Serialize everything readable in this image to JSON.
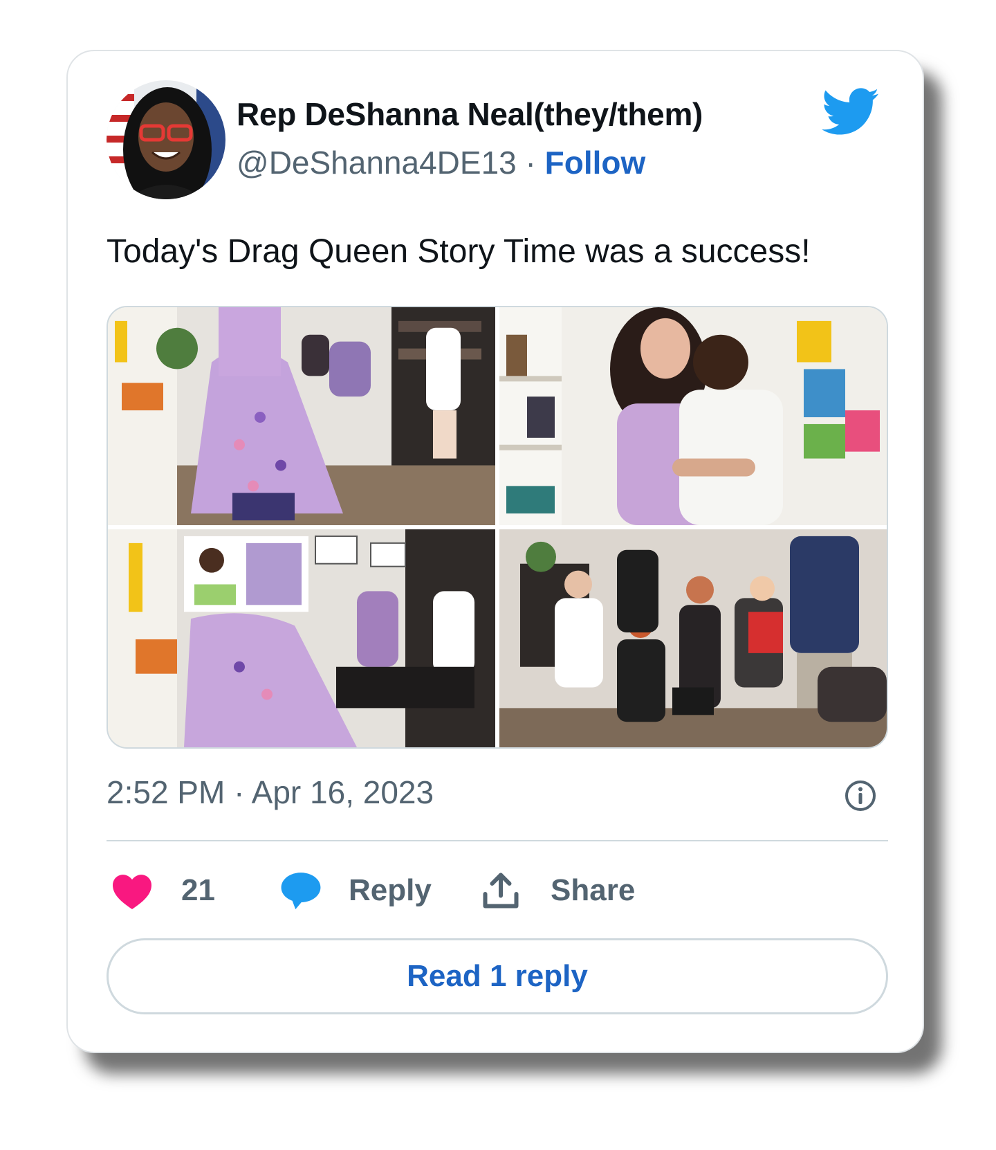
{
  "author": {
    "display_name": "Rep DeShanna Neal(they/them)",
    "handle": "@DeShanna4DE13",
    "separator": "·",
    "follow_label": "Follow",
    "avatar_icon": "profile-photo"
  },
  "brand": {
    "icon": "twitter-bird-icon",
    "color": "#1d9bf0"
  },
  "tweet": {
    "text": "Today's Drag Queen Story Time was a success!",
    "media_count": 4
  },
  "meta": {
    "time": "2:52 PM",
    "separator": "·",
    "date": "Apr 16, 2023",
    "info_icon": "info-icon"
  },
  "actions": {
    "like_icon": "heart-icon",
    "like_color": "#f91880",
    "like_count": "21",
    "reply_icon": "speech-bubble-icon",
    "reply_label": "Reply",
    "share_icon": "upload-share-icon",
    "share_label": "Share"
  },
  "read_replies": {
    "label": "Read 1 reply"
  },
  "colors": {
    "link": "#1d64c4",
    "secondary_text": "#536471",
    "border": "#cfd9de"
  }
}
